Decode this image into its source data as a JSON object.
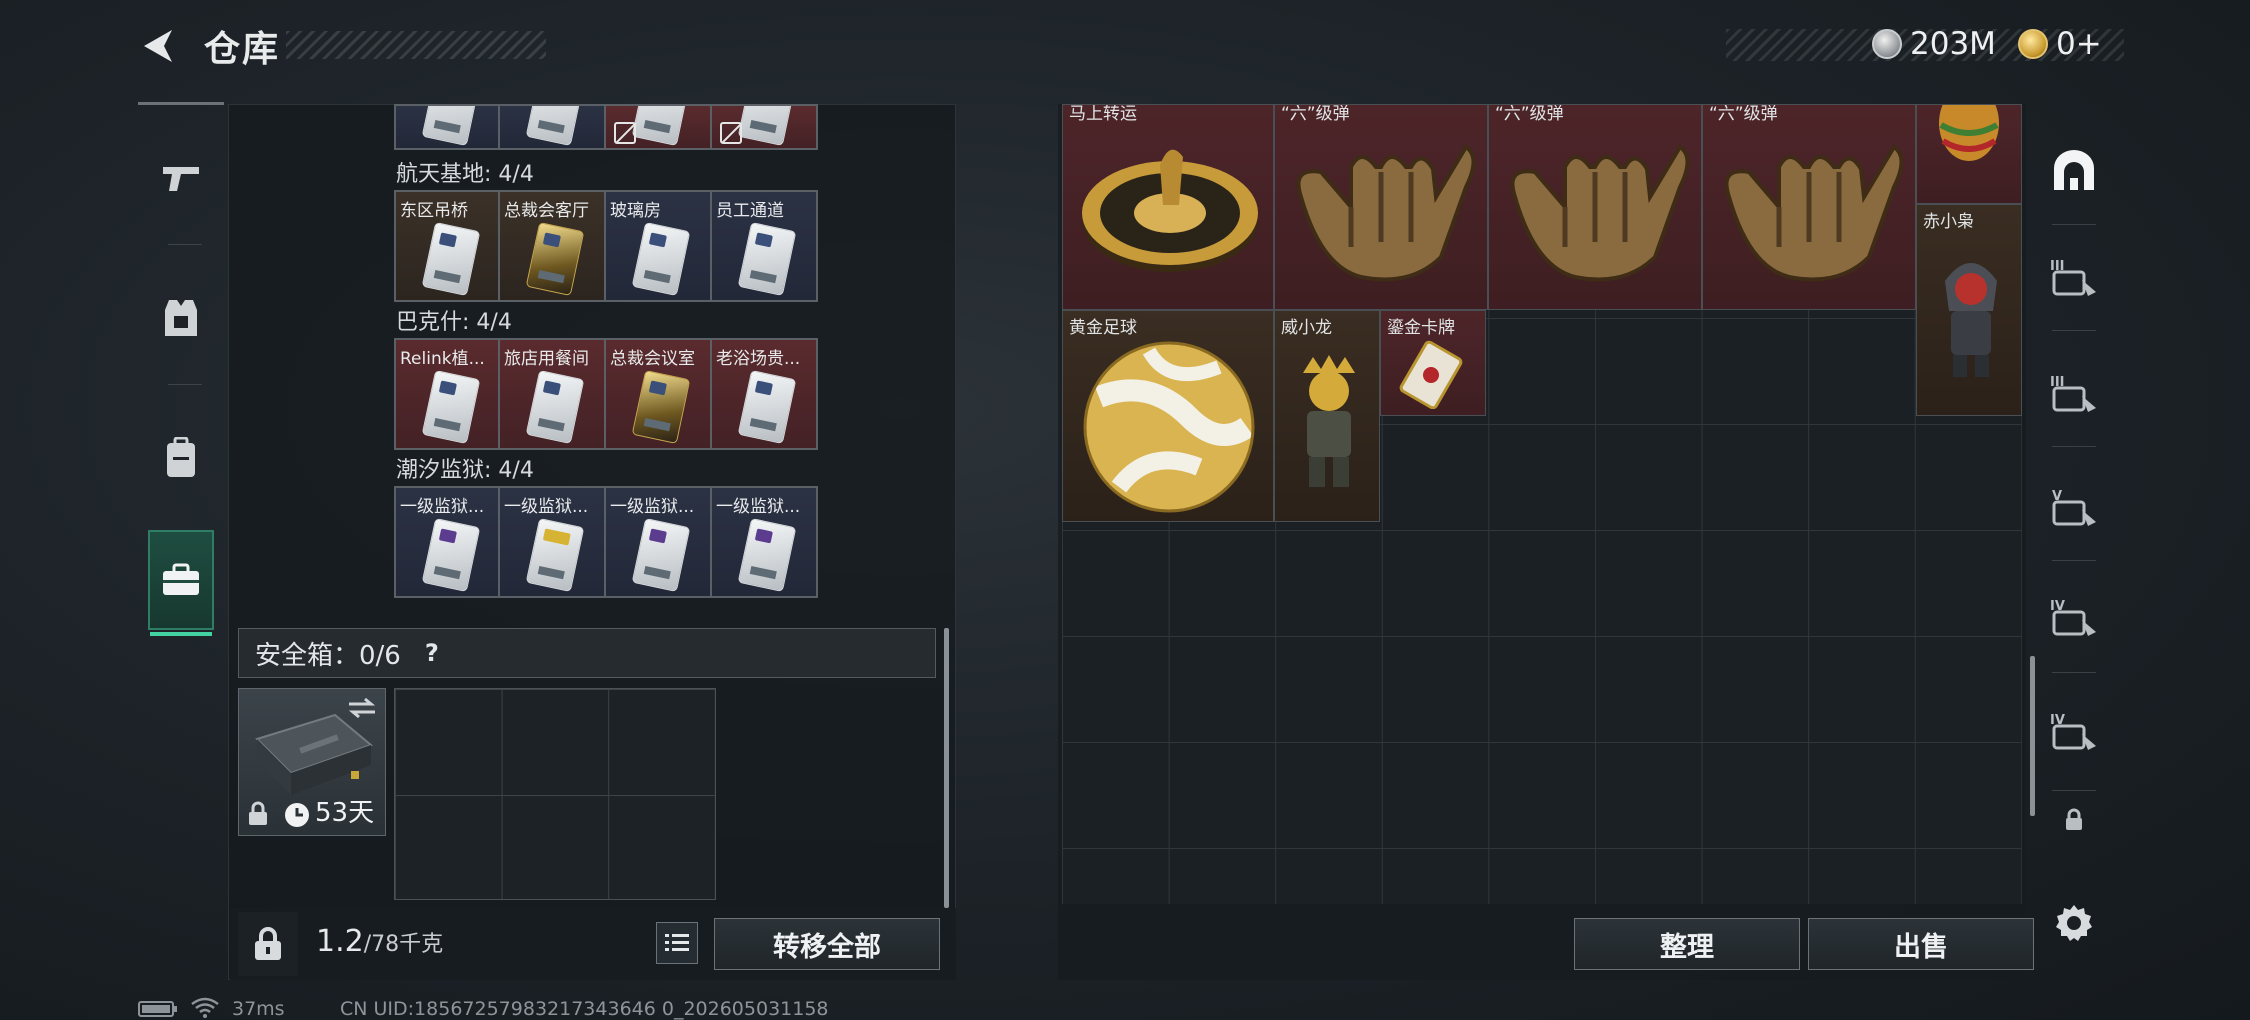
{
  "header": {
    "title": "仓库",
    "currency_silver": "203M",
    "currency_gold": "0+"
  },
  "left_nav": [
    {
      "name": "weapon-tab",
      "icon": "pistol-icon"
    },
    {
      "name": "armor-tab",
      "icon": "vest-icon"
    },
    {
      "name": "backpack-tab",
      "icon": "backpack-icon"
    },
    {
      "name": "keys-tab",
      "icon": "briefcase-icon",
      "active": true
    }
  ],
  "key_sections": [
    {
      "title": "航天基地: 4/4",
      "cards": [
        {
          "label": "东区吊桥",
          "bg": "brown",
          "card": "white"
        },
        {
          "label": "总裁会客厅",
          "bg": "brown",
          "card": "gold"
        },
        {
          "label": "玻璃房",
          "bg": "blue",
          "card": "white"
        },
        {
          "label": "员工通道",
          "bg": "blue",
          "card": "white"
        }
      ]
    },
    {
      "title": "巴克什: 4/4",
      "cards": [
        {
          "label": "Relink植...",
          "bg": "red",
          "card": "white"
        },
        {
          "label": "旅店用餐间",
          "bg": "red",
          "card": "white"
        },
        {
          "label": "总裁会议室",
          "bg": "red",
          "card": "gold"
        },
        {
          "label": "老浴场贵...",
          "bg": "red",
          "card": "white"
        }
      ]
    },
    {
      "title": "潮汐监狱: 4/4",
      "cards": [
        {
          "label": "一级监狱...",
          "bg": "blue",
          "card": "violet"
        },
        {
          "label": "一级监狱...",
          "bg": "blue",
          "card": "yellow"
        },
        {
          "label": "一级监狱...",
          "bg": "blue",
          "card": "violet"
        },
        {
          "label": "一级监狱...",
          "bg": "blue",
          "card": "violet"
        }
      ]
    }
  ],
  "safe_box": {
    "title": "安全箱：0/6",
    "help": "?",
    "duration": "53天"
  },
  "bottom": {
    "weight_current": "1.2",
    "weight_max": "/78千克",
    "transfer_all": "转移全部"
  },
  "stash": {
    "items": [
      {
        "label": "马上转运"
      },
      {
        "label": "“六”级弹"
      },
      {
        "label": "“六”级弹"
      },
      {
        "label": "“六”级弹"
      },
      {
        "label": "赤小枭"
      },
      {
        "label": "黄金足球"
      },
      {
        "label": "威小龙"
      },
      {
        "label": "鎏金卡牌"
      }
    ],
    "sort_button": "整理",
    "sell_button": "出售"
  },
  "right_nav": [
    {
      "name": "all-items-tab",
      "icon": "arch-icon"
    },
    {
      "name": "tier-3-case-tab",
      "icon": "case-iii-icon",
      "tier": "III"
    },
    {
      "name": "tier-3-case-tab-2",
      "icon": "case-iii-icon",
      "tier": "III"
    },
    {
      "name": "tier-5-case-tab",
      "icon": "case-v-icon",
      "tier": "V"
    },
    {
      "name": "tier-4-case-tab",
      "icon": "case-iv-icon",
      "tier": "IV"
    },
    {
      "name": "tier-4-case-tab-2",
      "icon": "case-iv-icon",
      "tier": "IV"
    }
  ],
  "status_bar": {
    "ping": "37ms",
    "uid": "CN UID:18567257983217343646 0_202605031158"
  }
}
